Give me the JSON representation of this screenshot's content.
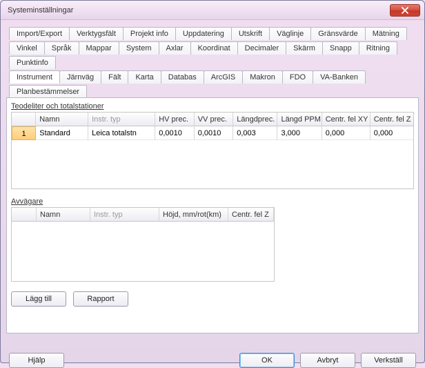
{
  "window": {
    "title": "Systeminställningar"
  },
  "tabs": {
    "row1": [
      "Import/Export",
      "Verktygsfält",
      "Projekt info",
      "Uppdatering",
      "Utskrift",
      "Väglinje",
      "Gränsvärde",
      "Mätning"
    ],
    "row2": [
      "Vinkel",
      "Språk",
      "Mappar",
      "System",
      "Axlar",
      "Koordinat",
      "Decimaler",
      "Skärm",
      "Snapp",
      "Ritning",
      "Punktinfo"
    ],
    "row3": [
      "Instrument",
      "Järnväg",
      "Fält",
      "Karta",
      "Databas",
      "ArcGIS",
      "Makron",
      "FDO",
      "VA-Banken",
      "Planbestämmelser"
    ],
    "active": "Instrument"
  },
  "group1": {
    "label_prefix": "T",
    "label_rest": "eodeliter och totalstationer",
    "headers": [
      "",
      "Namn",
      "Instr. typ",
      "HV prec.",
      "VV prec.",
      "Längdprec.",
      "Längd PPM",
      "Centr. fel XY",
      "Centr. fel Z"
    ],
    "rows": [
      {
        "no": "1",
        "namn": "Standard",
        "typ": "Leica totalstn",
        "hv": "0,0010",
        "vv": "0,0010",
        "lprec": "0,003",
        "lppm": "3,000",
        "cfxy": "0,000",
        "cfz": "0,000"
      }
    ]
  },
  "group2": {
    "label": "Avvägare",
    "headers": [
      "",
      "Namn",
      "Instr. typ",
      "Höjd, mm/rot(km)",
      "Centr. fel Z"
    ]
  },
  "buttons": {
    "add": "Lägg till",
    "report": "Rapport"
  },
  "footer": {
    "help": "Hjälp",
    "ok": "OK",
    "cancel": "Avbryt",
    "apply": "Verkställ"
  }
}
